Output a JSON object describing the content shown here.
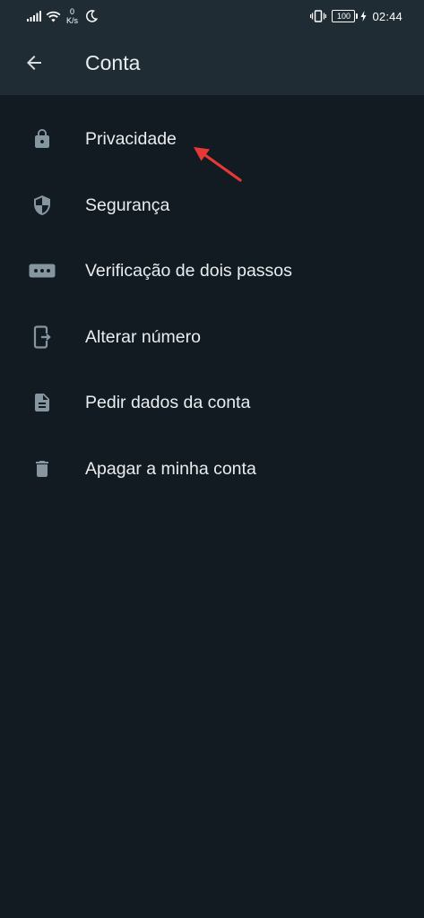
{
  "status_bar": {
    "netspeed_value": "0",
    "netspeed_unit": "K/s",
    "battery": "100",
    "time": "02:44",
    "icons": [
      "signal-icon",
      "wifi-icon",
      "moon-icon",
      "vibrate-icon",
      "battery-icon",
      "charging-icon"
    ]
  },
  "header": {
    "title": "Conta",
    "back_icon": "arrow-back-icon"
  },
  "menu": {
    "items": [
      {
        "label": "Privacidade",
        "icon": "lock-icon"
      },
      {
        "label": "Segurança",
        "icon": "shield-icon"
      },
      {
        "label": "Verificação de dois passos",
        "icon": "dots-icon"
      },
      {
        "label": "Alterar número",
        "icon": "change-number-icon"
      },
      {
        "label": "Pedir dados da conta",
        "icon": "document-icon"
      },
      {
        "label": "Apagar a minha conta",
        "icon": "trash-icon"
      }
    ]
  },
  "annotation": {
    "arrow_color": "#e53935",
    "points_to": "Privacidade"
  },
  "colors": {
    "background": "#121b22",
    "bar": "#1f2c34",
    "text": "#e9edef",
    "icon": "#8696a0"
  }
}
